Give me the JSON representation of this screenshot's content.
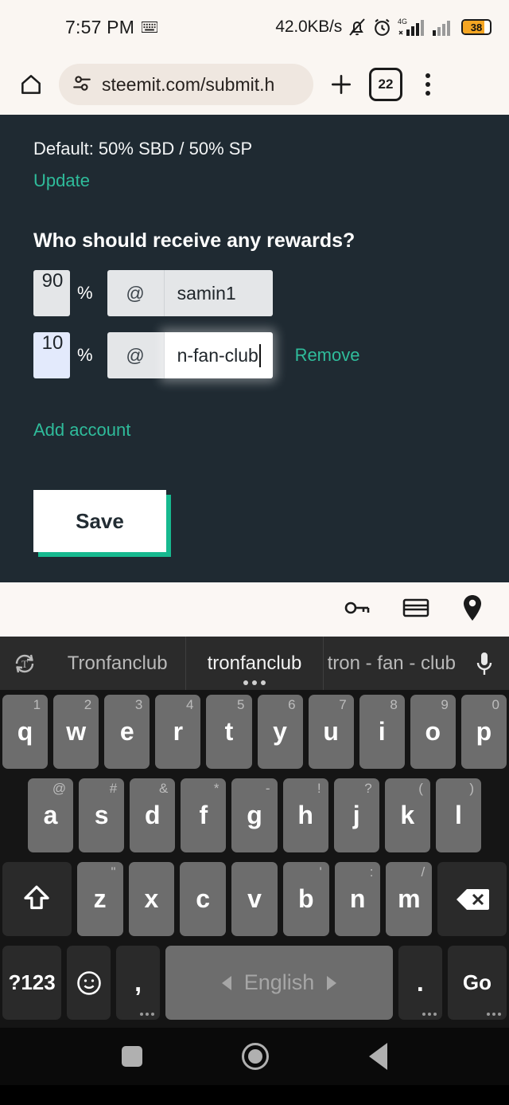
{
  "status_bar": {
    "time": "7:57 PM",
    "keyboard_icon": "keyboard-icon",
    "network_speed": "42.0KB/s",
    "mute_icon": "bell-muted-icon",
    "alarm_icon": "alarm-clock-icon",
    "signal_label": "4G",
    "battery_level": "38"
  },
  "toolbar": {
    "home_icon": "home-icon",
    "site_settings_icon": "tune-icon",
    "url": "steemit.com/submit.h",
    "new_tab_icon": "plus-icon",
    "tab_count": "22",
    "menu_icon": "overflow-menu-icon"
  },
  "page": {
    "default_line": "Default: 50% SBD / 50% SP",
    "update_link": "Update",
    "question": "Who should receive any rewards?",
    "percent_sign": "%",
    "at_sign": "@",
    "beneficiaries": [
      {
        "percent": "90",
        "account": "samin1",
        "focused": false,
        "autofill": false,
        "remove_label": ""
      },
      {
        "percent": "10",
        "account": "n-fan-club",
        "focused": true,
        "autofill": true,
        "remove_label": "Remove"
      }
    ],
    "add_account_link": "Add account",
    "save_label": "Save"
  },
  "autofill_bar": {
    "icons": [
      "key-icon",
      "credit-card-icon",
      "location-pin-icon"
    ]
  },
  "keyboard": {
    "transliterate_icon": "transliterate-icon",
    "mic_icon": "microphone-icon",
    "suggestions": [
      {
        "text": "Tronfanclub",
        "active": false
      },
      {
        "text": "tronfanclub",
        "active": true
      },
      {
        "text": "tron - fan - club",
        "active": false
      }
    ],
    "row1": [
      {
        "key": "q",
        "hint": "1"
      },
      {
        "key": "w",
        "hint": "2"
      },
      {
        "key": "e",
        "hint": "3"
      },
      {
        "key": "r",
        "hint": "4"
      },
      {
        "key": "t",
        "hint": "5"
      },
      {
        "key": "y",
        "hint": "6"
      },
      {
        "key": "u",
        "hint": "7"
      },
      {
        "key": "i",
        "hint": "8"
      },
      {
        "key": "o",
        "hint": "9"
      },
      {
        "key": "p",
        "hint": "0"
      }
    ],
    "row2": [
      {
        "key": "a",
        "hint": "@"
      },
      {
        "key": "s",
        "hint": "#"
      },
      {
        "key": "d",
        "hint": "&"
      },
      {
        "key": "f",
        "hint": "*"
      },
      {
        "key": "g",
        "hint": "-"
      },
      {
        "key": "h",
        "hint": "!"
      },
      {
        "key": "j",
        "hint": "?"
      },
      {
        "key": "k",
        "hint": "("
      },
      {
        "key": "l",
        "hint": ")"
      }
    ],
    "row3": [
      {
        "key": "z",
        "hint": "\""
      },
      {
        "key": "x",
        "hint": ""
      },
      {
        "key": "c",
        "hint": ""
      },
      {
        "key": "v",
        "hint": ""
      },
      {
        "key": "b",
        "hint": "'"
      },
      {
        "key": "n",
        "hint": ":"
      },
      {
        "key": "m",
        "hint": "/"
      }
    ],
    "shift_icon": "shift-icon",
    "backspace_icon": "backspace-icon",
    "symbols_label": "?123",
    "emoji_icon": "emoji-icon",
    "comma_label": ",",
    "space_label": "English",
    "period_label": ".",
    "go_label": "Go"
  },
  "nav_bar": {
    "recents_icon": "recents-square-icon",
    "home_icon": "home-circle-icon",
    "back_icon": "back-triangle-icon"
  }
}
